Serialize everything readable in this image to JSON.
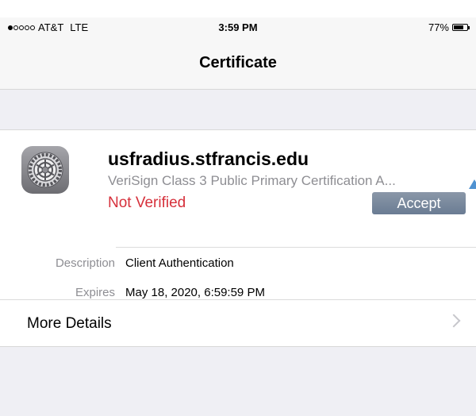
{
  "status_bar": {
    "carrier": "AT&T",
    "network": "LTE",
    "time": "3:59 PM",
    "battery_text": "77%",
    "battery_level": 0.77,
    "signal_bars_filled": 1,
    "signal_bars_total": 5
  },
  "nav": {
    "title": "Certificate"
  },
  "certificate": {
    "icon": "settings-gear-icon",
    "host": "usfradius.stfrancis.edu",
    "issuer": "VeriSign Class 3 Public Primary Certification A...",
    "status": "Not Verified",
    "status_color": "#d6303b",
    "accept_label": "Accept"
  },
  "details": {
    "description_label": "Description",
    "description_value": "Client Authentication",
    "expires_label": "Expires",
    "expires_value": "May 18, 2020, 6:59:59 PM"
  },
  "more_details": {
    "label": "More Details"
  }
}
